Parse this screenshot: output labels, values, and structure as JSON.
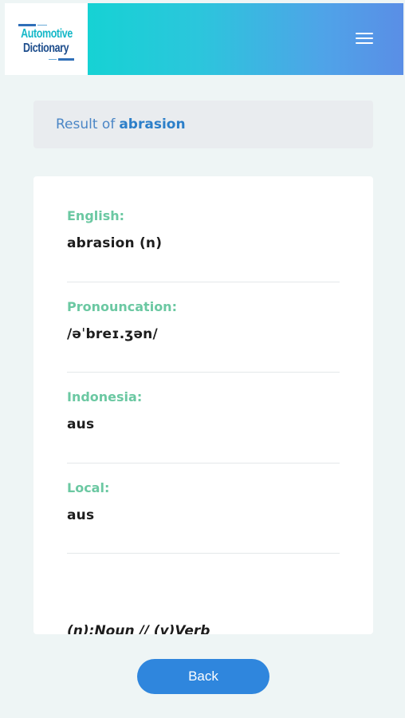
{
  "header": {
    "logo_line1": "Automotive",
    "logo_line2": "Dictionary",
    "menu_icon": "hamburger-menu-icon"
  },
  "result": {
    "prefix": "Result of",
    "term": "abrasion"
  },
  "entries": [
    {
      "label": "English:",
      "value": "abrasion (n)"
    },
    {
      "label": "Pronouncation:",
      "value": "/əˈbreɪ.ʒən/"
    },
    {
      "label": "Indonesia:",
      "value": "aus"
    },
    {
      "label": "Local:",
      "value": "aus"
    }
  ],
  "legend": "(n):Noun // (v)Verb",
  "back_label": "Back",
  "colors": {
    "header_gradient_start": "#16d2d4",
    "header_gradient_end": "#5a8ee6",
    "label_green": "#6bc8a2",
    "accent_blue": "#2f86dd",
    "background": "#eef5f5"
  }
}
